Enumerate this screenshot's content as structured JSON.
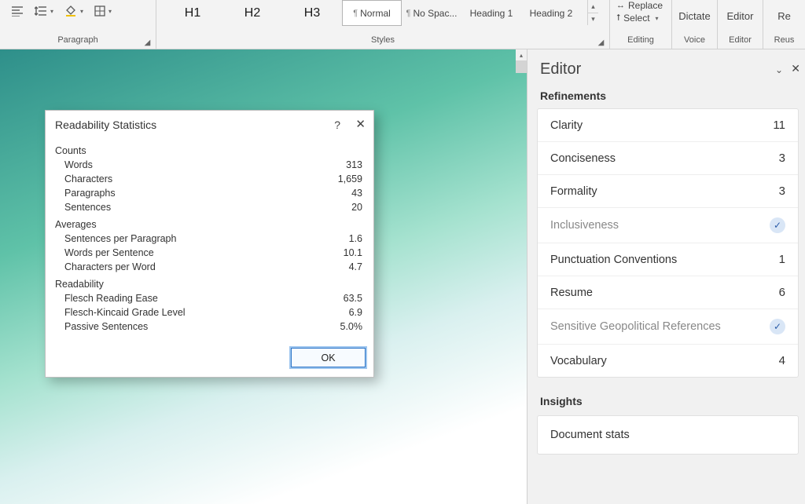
{
  "ribbon": {
    "paragraph_label": "Paragraph",
    "styles_label": "Styles",
    "editing_label": "Editing",
    "voice_label": "Voice",
    "editor_group_label": "Editor",
    "reuse_label": "Reus",
    "replace_label": "Replace",
    "select_label": "Select",
    "dictate_label": "Dictate",
    "editor_btn": "Editor",
    "reuse_btn": "Re",
    "styles": {
      "h1": "H1",
      "h2": "H2",
      "h3": "H3",
      "normal": "Normal",
      "nospacing": "No Spac...",
      "heading1": "Heading 1",
      "heading2": "Heading 2"
    }
  },
  "dialog": {
    "title": "Readability Statistics",
    "help": "?",
    "sections": {
      "counts": "Counts",
      "averages": "Averages",
      "readability": "Readability"
    },
    "counts": {
      "words_l": "Words",
      "words_v": "313",
      "chars_l": "Characters",
      "chars_v": "1,659",
      "paras_l": "Paragraphs",
      "paras_v": "43",
      "sents_l": "Sentences",
      "sents_v": "20"
    },
    "averages": {
      "spp_l": "Sentences per Paragraph",
      "spp_v": "1.6",
      "wps_l": "Words per Sentence",
      "wps_v": "10.1",
      "cpw_l": "Characters per Word",
      "cpw_v": "4.7"
    },
    "readability": {
      "fre_l": "Flesch Reading Ease",
      "fre_v": "63.5",
      "fkg_l": "Flesch-Kincaid Grade Level",
      "fkg_v": "6.9",
      "pas_l": "Passive Sentences",
      "pas_v": "5.0%"
    },
    "ok": "OK"
  },
  "editor": {
    "title": "Editor",
    "refinements": "Refinements",
    "insights": "Insights",
    "docstats": "Document stats",
    "items": [
      {
        "label": "Clarity",
        "value": "11",
        "muted": false,
        "check": false
      },
      {
        "label": "Conciseness",
        "value": "3",
        "muted": false,
        "check": false
      },
      {
        "label": "Formality",
        "value": "3",
        "muted": false,
        "check": false
      },
      {
        "label": "Inclusiveness",
        "value": "",
        "muted": true,
        "check": true
      },
      {
        "label": "Punctuation Conventions",
        "value": "1",
        "muted": false,
        "check": false
      },
      {
        "label": "Resume",
        "value": "6",
        "muted": false,
        "check": false
      },
      {
        "label": "Sensitive Geopolitical References",
        "value": "",
        "muted": true,
        "check": true
      },
      {
        "label": "Vocabulary",
        "value": "4",
        "muted": false,
        "check": false
      }
    ]
  }
}
